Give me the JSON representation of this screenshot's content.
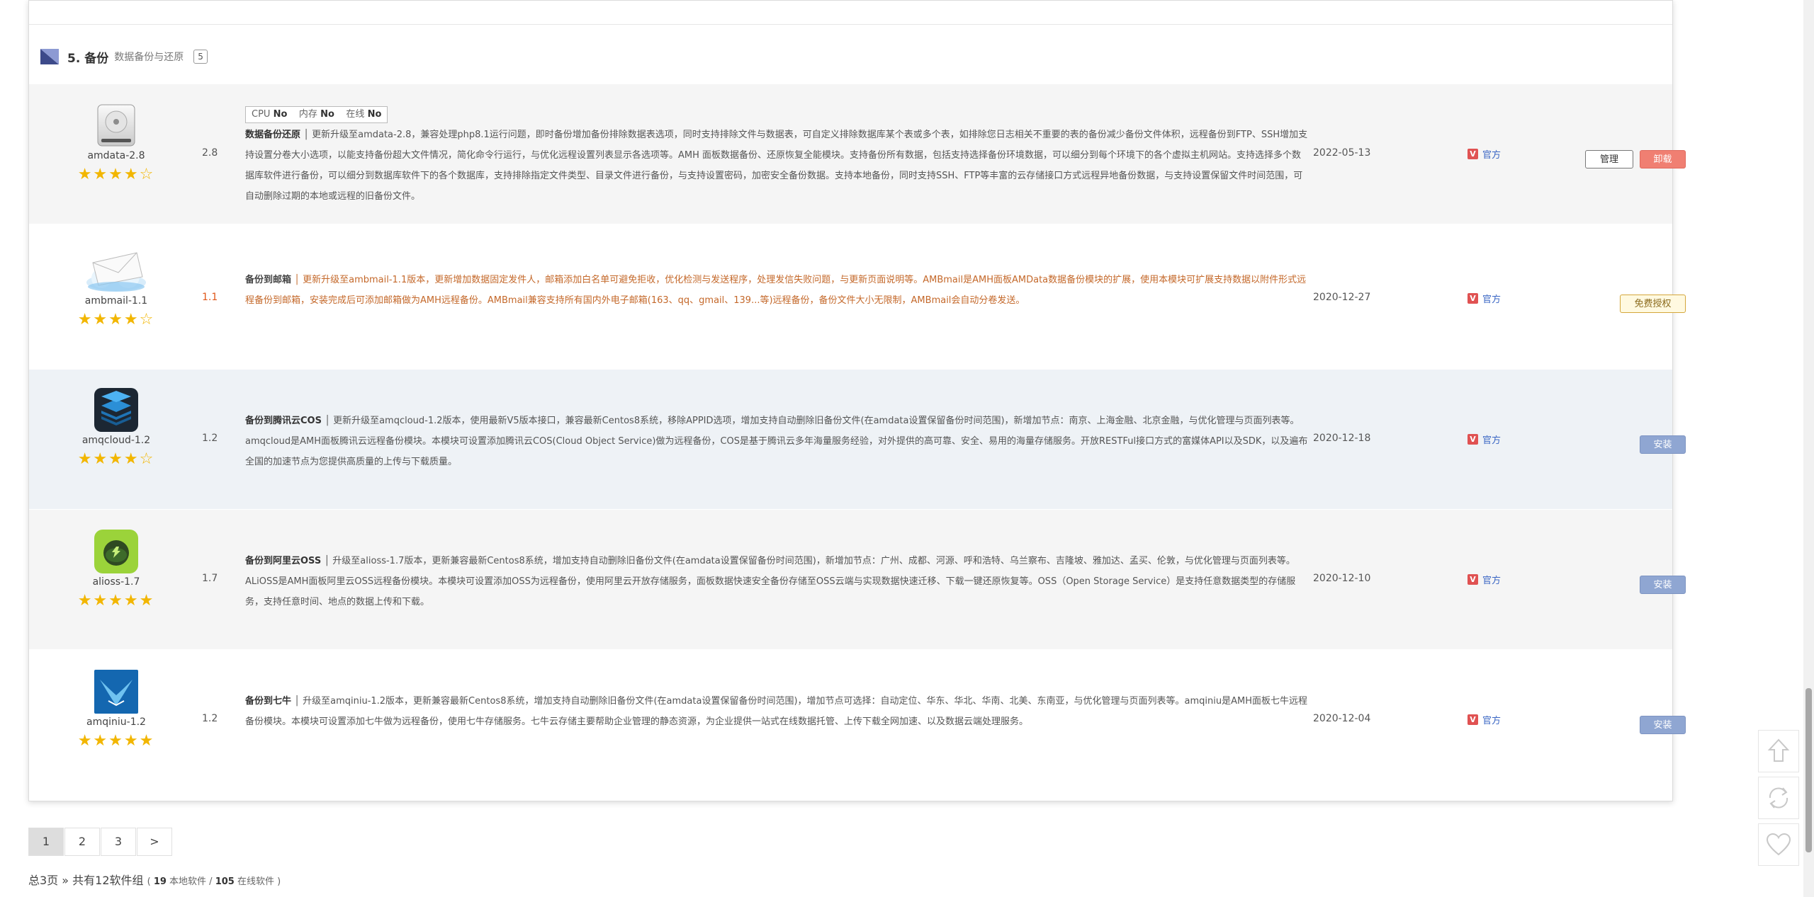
{
  "section": {
    "title": "5. 备份",
    "subtitle": "数据备份与还原",
    "count": "5"
  },
  "items": [
    {
      "name": "amdata-2.8",
      "version": "2.8",
      "meta": {
        "cpu_label": "CPU",
        "cpu": "No",
        "mem_label": "内存",
        "mem": "No",
        "online_label": "在线",
        "online": "No"
      },
      "title": "数据备份还原",
      "desc": "更新升级至amdata-2.8，兼容处理php8.1运行问题，即时备份增加备份排除数据表选项，同时支持排除文件与数据表，可自定义排除数据库某个表或多个表，如排除您日志相关不重要的表的备份减少备份文件体积，远程备份到FTP、SSH增加支持设置分卷大小选项，以能支持备份超大文件情况，简化命令行运行，与优化远程设置列表显示各选项等。AMH 面板数据备份、还原恢复全能模块。支持备份所有数据，包括支持选择备份环境数据，可以细分到每个环境下的各个虚拟主机网站。支持选择多个数据库软件进行备份，可以细分到数据库软件下的各个数据库，支持排除指定文件类型、目录文件进行备份，与支持设置密码，加密安全备份数据。支持本地备份，同时支持SSH、FTP等丰富的云存储接口方式远程异地备份数据，与支持设置保留文件时间范围，可自动删除过期的本地或远程的旧备份文件。",
      "date": "2022-05-13",
      "official": "官方",
      "rating": "★★★★☆",
      "buttons": [
        "管理",
        "卸载"
      ]
    },
    {
      "name": "ambmail-1.1",
      "version": "1.1",
      "title": "备份到邮箱",
      "desc": "更新升级至ambmail-1.1版本，更新增加数据固定发件人，邮箱添加白名单可避免拒收，优化检测与发送程序，处理发信失败问题，与更新页面说明等。AMBmail是AMH面板AMData数据备份模块的扩展，使用本模块可扩展支持数据以附件形式远程备份到邮箱，安装完成后可添加邮箱做为AMH远程备份。AMBmail兼容支持所有国内外电子邮箱(163、qq、gmail、139...等)远程备份，备份文件大小无限制，AMBmail会自动分卷发送。",
      "date": "2020-12-27",
      "official": "官方",
      "rating": "★★★★☆",
      "buttons": [
        "免费授权"
      ]
    },
    {
      "name": "amqcloud-1.2",
      "version": "1.2",
      "title": "备份到腾讯云COS",
      "desc": "更新升级至amqcloud-1.2版本，使用最新V5版本接口，兼容最新Centos8系统，移除APPID选项，增加支持自动删除旧备份文件(在amdata设置保留备份时间范围)，新增加节点：南京、上海金融、北京金融，与优化管理与页面列表等。amqcloud是AMH面板腾讯云远程备份模块。本模块可设置添加腾讯云COS(Cloud Object Service)做为远程备份，COS是基于腾讯云多年海量服务经验，对外提供的高可靠、安全、易用的海量存储服务。开放RESTFul接口方式的富媒体API以及SDK，以及遍布全国的加速节点为您提供高质量的上传与下载质量。",
      "date": "2020-12-18",
      "official": "官方",
      "rating": "★★★★☆",
      "buttons": [
        "安装"
      ]
    },
    {
      "name": "alioss-1.7",
      "version": "1.7",
      "title": "备份到阿里云OSS",
      "desc": "升级至alioss-1.7版本，更新兼容最新Centos8系统，增加支持自动删除旧备份文件(在amdata设置保留备份时间范围)，新增加节点：广州、成都、河源、呼和浩特、乌兰察布、吉隆坡、雅加达、孟买、伦敦，与优化管理与页面列表等。ALiOSS是AMH面板阿里云OSS远程备份模块。本模块可设置添加OSS为远程备份，使用阿里云开放存储服务，面板数据快速安全备份存储至OSS云端与实现数据快速迁移、下载一键还原恢复等。OSS（Open Storage Service）是支持任意数据类型的存储服务，支持任意时间、地点的数据上传和下载。",
      "date": "2020-12-10",
      "official": "官方",
      "rating": "★★★★★",
      "buttons": [
        "安装"
      ]
    },
    {
      "name": "amqiniu-1.2",
      "version": "1.2",
      "title": "备份到七牛",
      "desc": "升级至amqiniu-1.2版本，更新兼容最新Centos8系统，增加支持自动删除旧备份文件(在amdata设置保留备份时间范围)，增加节点可选择：自动定位、华东、华北、华南、北美、东南亚，与优化管理与页面列表等。amqiniu是AMH面板七牛远程备份模块。本模块可设置添加七牛做为远程备份，使用七牛存储服务。七牛云存储主要帮助企业管理的静态资源，为企业提供一站式在线数据托管、上传下载全网加速、以及数据云端处理服务。",
      "date": "2020-12-04",
      "official": "官方",
      "rating": "★★★★★",
      "buttons": [
        "安装"
      ]
    }
  ],
  "pager": {
    "pages": [
      "1",
      "2",
      "3",
      ">"
    ]
  },
  "footer": {
    "summary": "总3页 » 共有12软件组",
    "paren_open": "( ",
    "local_count": "19",
    "local_label": " 本地软件 / ",
    "online_count": "105",
    "online_label": " 在线软件 )"
  }
}
